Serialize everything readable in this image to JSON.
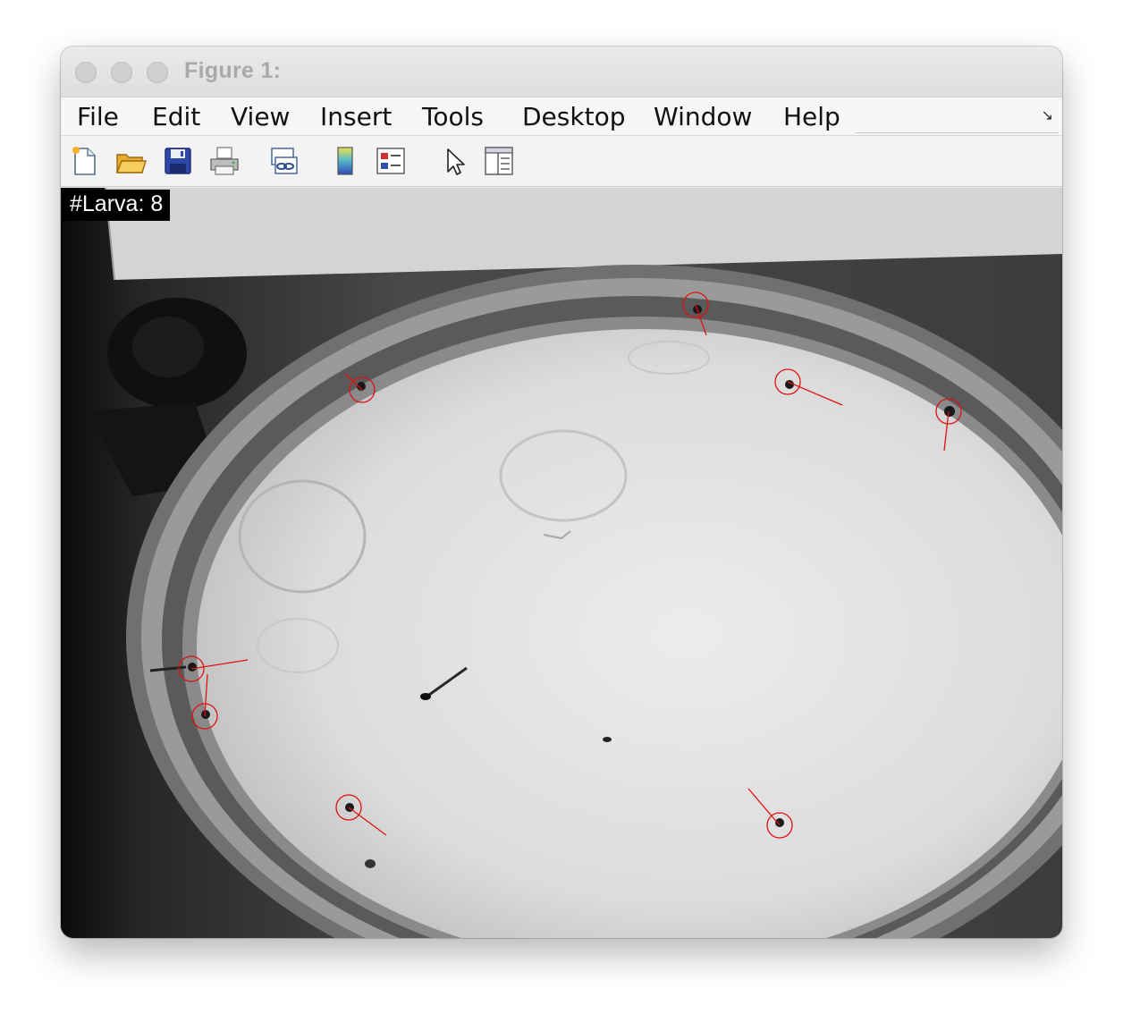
{
  "window": {
    "title": "Figure 1:"
  },
  "menubar": {
    "items": [
      "File",
      "Edit",
      "View",
      "Insert",
      "Tools",
      "Desktop",
      "Window",
      "Help"
    ]
  },
  "toolbar": {
    "buttons": [
      {
        "name": "new-figure-icon"
      },
      {
        "name": "open-file-icon"
      },
      {
        "name": "save-icon"
      },
      {
        "name": "print-icon"
      },
      {
        "name": "link-plot-icon"
      },
      {
        "name": "colorbar-icon"
      },
      {
        "name": "legend-icon"
      },
      {
        "name": "edit-plot-pointer-icon"
      },
      {
        "name": "property-inspector-icon"
      }
    ]
  },
  "figure": {
    "label": "#Larva: 8",
    "marker_color": "#e01010"
  }
}
